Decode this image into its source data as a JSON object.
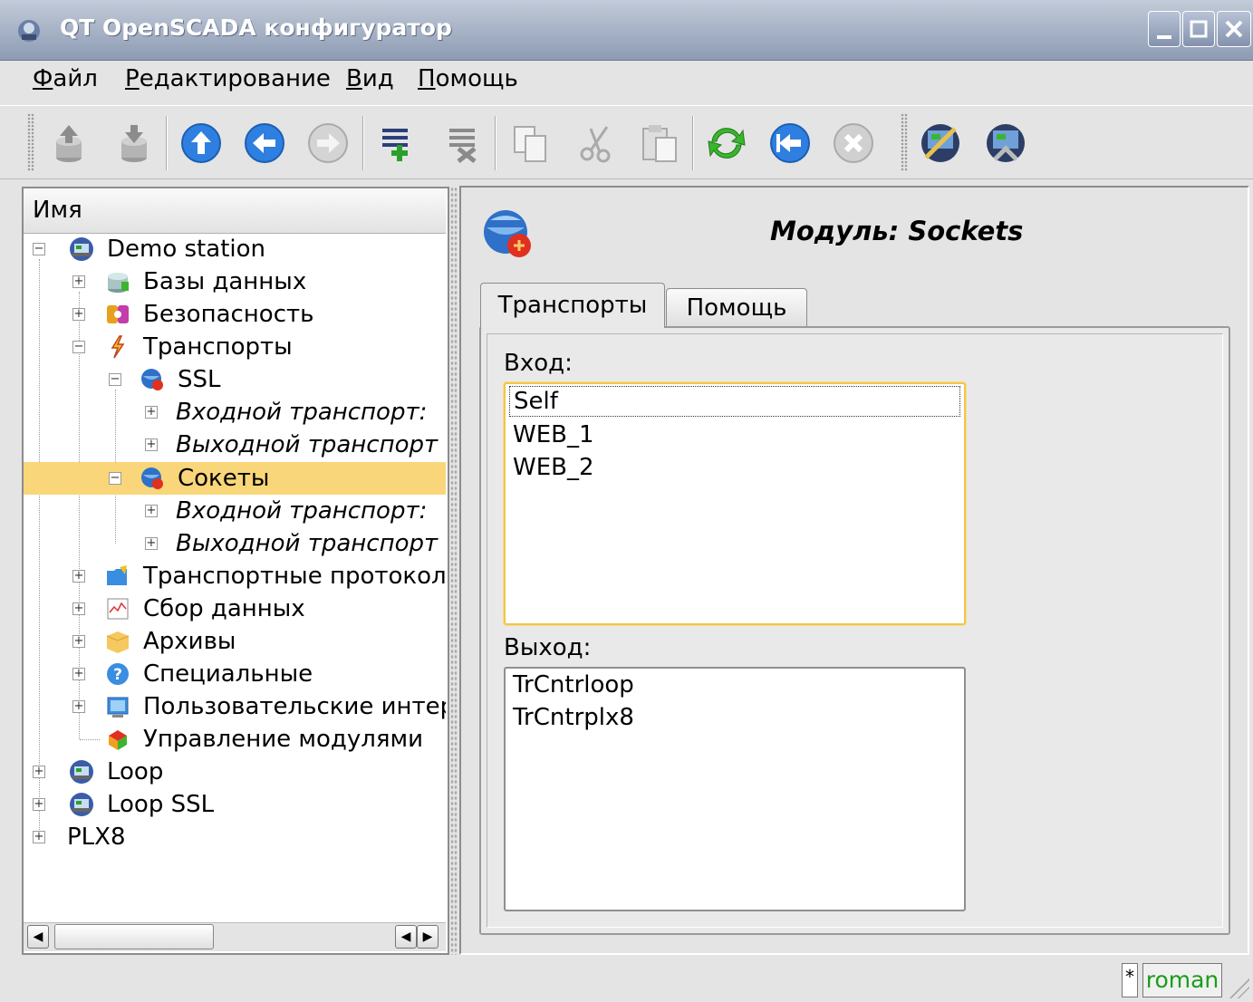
{
  "window": {
    "title": "QT OpenSCADA конфигуратор"
  },
  "menu": [
    {
      "label": "Файл",
      "underline": "Ф",
      "rest": "айл"
    },
    {
      "label": "Редактирование",
      "underline": "Р",
      "rest": "едактирование"
    },
    {
      "label": "Вид",
      "underline": "В",
      "rest": "ид"
    },
    {
      "label": "Помощь",
      "underline": "П",
      "rest": "омощь"
    }
  ],
  "toolbar": {
    "buttons": [
      "load",
      "save",
      "up",
      "back",
      "forward",
      "add",
      "delete",
      "copy",
      "cut",
      "paste",
      "refresh",
      "start",
      "stop",
      "station-1",
      "station-2"
    ]
  },
  "tree": {
    "header": "Имя",
    "items": [
      {
        "label": "Demo station"
      },
      {
        "label": "Базы данных"
      },
      {
        "label": "Безопасность"
      },
      {
        "label": "Транспорты"
      },
      {
        "label": "SSL"
      },
      {
        "label": "Входной транспорт:"
      },
      {
        "label": "Выходной транспорт"
      },
      {
        "label": "Сокеты"
      },
      {
        "label": "Входной транспорт:"
      },
      {
        "label": "Выходной транспорт"
      },
      {
        "label": "Транспортные протоколы"
      },
      {
        "label": "Сбор данных"
      },
      {
        "label": "Архивы"
      },
      {
        "label": "Специальные"
      },
      {
        "label": "Пользовательские интерфейсы"
      },
      {
        "label": "Управление модулями"
      },
      {
        "label": "Loop"
      },
      {
        "label": "Loop SSL"
      },
      {
        "label": "PLX8"
      }
    ],
    "selected_index": 7
  },
  "page": {
    "title": "Модуль: Sockets",
    "tabs": [
      {
        "label": "Транспорты",
        "active": true
      },
      {
        "label": "Помощь",
        "active": false
      }
    ],
    "input_label": "Вход:",
    "input_items": [
      "Self",
      "WEB_1",
      "WEB_2"
    ],
    "output_label": "Выход:",
    "output_items": [
      "TrCntrloop",
      "TrCntrplx8"
    ]
  },
  "status": {
    "modified": "*",
    "user": "roman"
  },
  "colors": {
    "selection": "#f9d67a",
    "focus_border": "#f2c64b",
    "user_text": "#1c9c1c"
  }
}
